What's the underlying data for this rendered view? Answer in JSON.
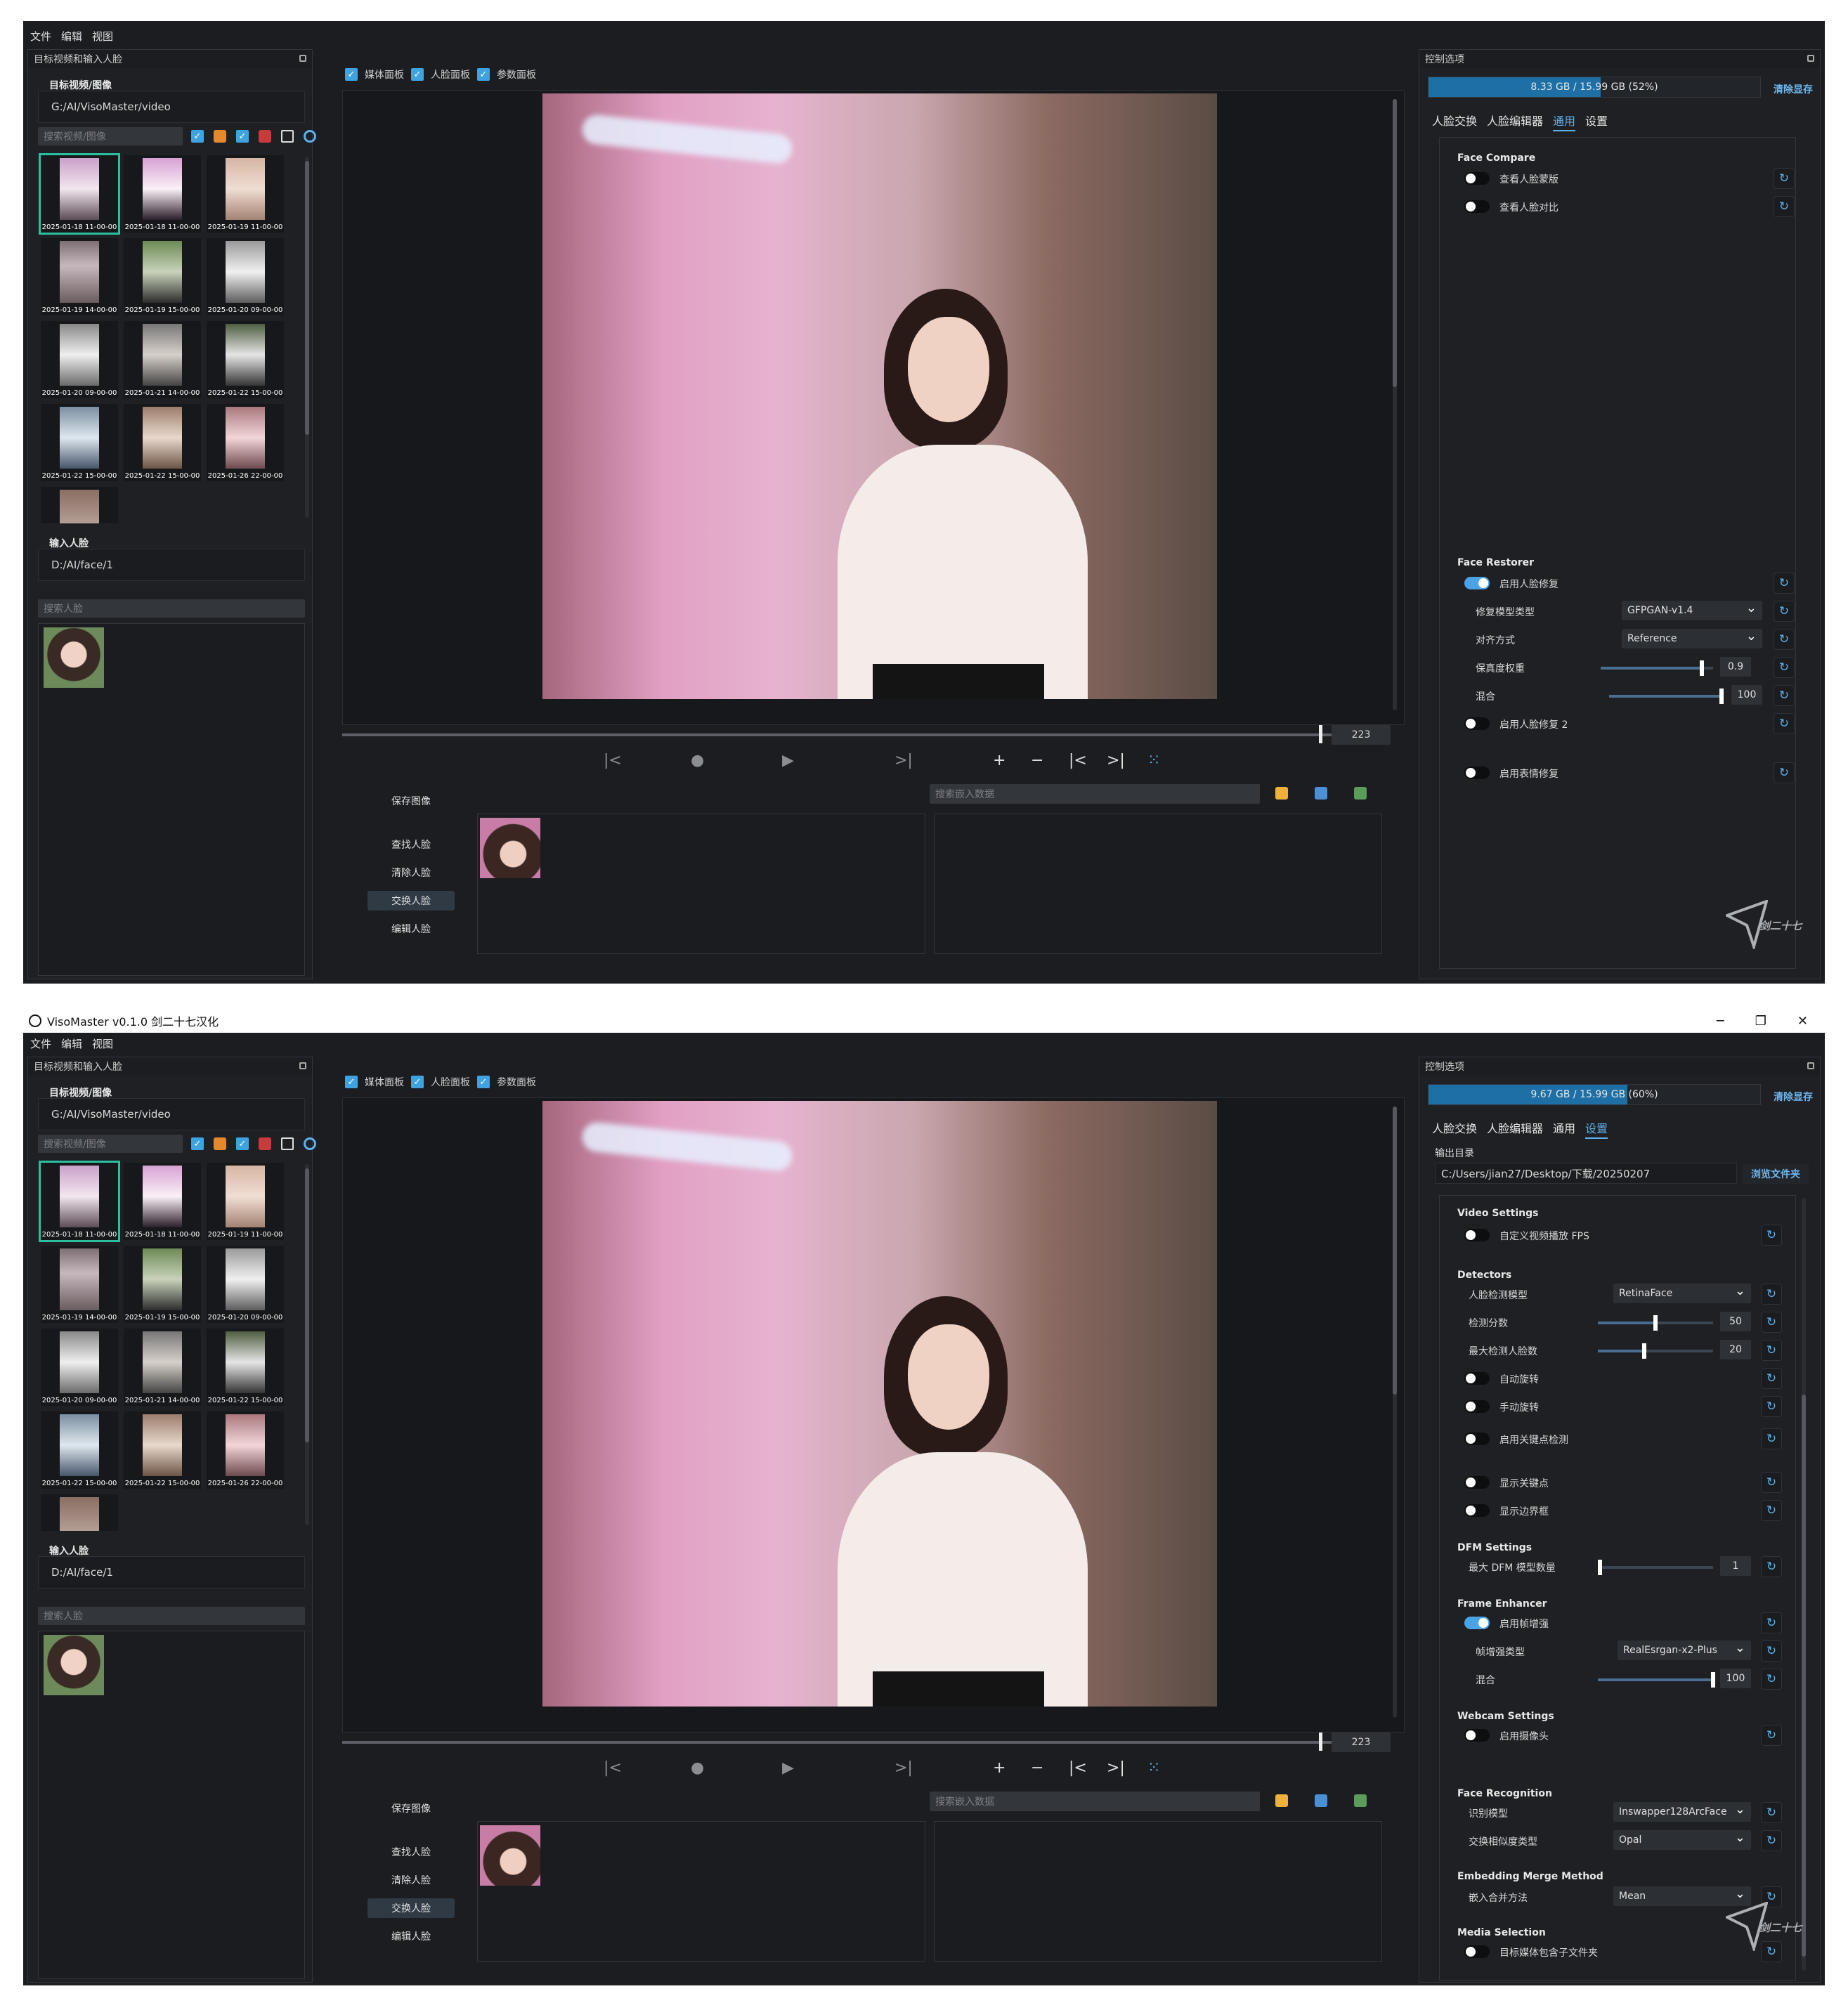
{
  "menu": [
    "文件",
    "编辑",
    "视图"
  ],
  "window_title": "VisoMaster v0.1.0 剑二十七汉化",
  "window_controls": {
    "minimize": "─",
    "restore": "❐",
    "close": "✕"
  },
  "left": {
    "dock_title": "目标视频和输入人脸",
    "target_label": "目标视频/图像",
    "target_path": "G:/AI/VisoMaster/video",
    "search_video_placeholder": "搜索视频/图像",
    "thumb_captions": [
      "2025-01-18 11-00-00",
      "2025-01-18 11-00-00",
      "2025-01-19 11-00-00",
      "2025-01-19 14-00-00",
      "2025-01-19 15-00-00",
      "2025-01-20 09-00-00",
      "2025-01-20 09-00-00",
      "2025-01-21 14-00-00",
      "2025-01-22 15-00-00",
      "2025-01-22 15-00-00",
      "2025-01-22 15-00-00",
      "2025-01-26 22-00-00",
      ""
    ],
    "input_face_label": "输入人脸",
    "input_face_path": "D:/AI/face/1",
    "search_face_placeholder": "搜索人脸"
  },
  "center": {
    "checkboxes": [
      "媒体面板",
      "人脸面板",
      "参数面板"
    ],
    "frame_number": "223",
    "save_image": "保存图像",
    "find_faces": "查找人脸",
    "clear_faces": "清除人脸",
    "swap_faces": "交换人脸",
    "edit_faces": "编辑人脸",
    "search_embed_placeholder": "搜索嵌入数据",
    "transport": {
      "prev": "|<",
      "record": "●",
      "play": "▶",
      "next": ">|",
      "plus": "+",
      "minus": "−",
      "first": "|<",
      "last": ">|",
      "grid": "⁙"
    }
  },
  "right_top": {
    "dock_title": "控制选项",
    "memory": {
      "text": "8.33 GB / 15.99 GB (52%)",
      "percent": 52
    },
    "clear_vram": "清除显存",
    "tabs": [
      "人脸交换",
      "人脸编辑器",
      "通用",
      "设置"
    ],
    "active_tab": "通用",
    "face_compare": "Face Compare",
    "view_mask": "查看人脸蒙版",
    "view_compare": "查看人脸对比",
    "face_restorer": "Face Restorer",
    "enable_restore": "启用人脸修复",
    "restore_model_label": "修复模型类型",
    "restore_model_value": "GFPGAN-v1.4",
    "align_label": "对齐方式",
    "align_value": "Reference",
    "fidelity_label": "保真度权重",
    "fidelity_value": "0.9",
    "fidelity_level": 0.9,
    "blend_label": "混合",
    "blend_value": "100",
    "blend_level": 1.0,
    "enable_restore2": "启用人脸修复 2",
    "enable_expression": "启用表情修复",
    "watermark": "剑二十七"
  },
  "right_bottom": {
    "dock_title": "控制选项",
    "memory": {
      "text": "9.67 GB / 15.99 GB (60%)",
      "percent": 60
    },
    "clear_vram": "清除显存",
    "tabs": [
      "人脸交换",
      "人脸编辑器",
      "通用",
      "设置"
    ],
    "active_tab": "设置",
    "output_dir_label": "输出目录",
    "output_dir": "C:/Users/jian27/Desktop/下载/20250207",
    "browse": "浏览文件夹",
    "video_settings": "Video Settings",
    "custom_fps": "自定义视频播放 FPS",
    "detectors": "Detectors",
    "detect_model_label": "人脸检测模型",
    "detect_model_value": "RetinaFace",
    "detect_score_label": "检测分数",
    "detect_score_value": "50",
    "detect_score_level": 0.5,
    "max_faces_label": "最大检测人脸数",
    "max_faces_value": "20",
    "max_faces_level": 0.4,
    "auto_rotate": "自动旋转",
    "manual_rotate": "手动旋转",
    "keypoint_detect": "启用关键点检测",
    "show_keypoints": "显示关键点",
    "show_bbox": "显示边界框",
    "dfm_settings": "DFM Settings",
    "max_dfm_label": "最大 DFM 模型数量",
    "max_dfm_value": "1",
    "max_dfm_level": 0.0,
    "frame_enhancer": "Frame Enhancer",
    "enable_enhancer": "启用帧增强",
    "enhancer_type_label": "帧增强类型",
    "enhancer_type_value": "RealEsrgan-x2-Plus",
    "enh_blend_label": "混合",
    "enh_blend_value": "100",
    "enh_blend_level": 1.0,
    "webcam_settings": "Webcam Settings",
    "enable_webcam": "启用摄像头",
    "face_recognition": "Face Recognition",
    "recog_model_label": "识别模型",
    "recog_model_value": "Inswapper128ArcFace",
    "swap_sim_label": "交换相似度类型",
    "swap_sim_value": "Opal",
    "embedding_merge": "Embedding Merge Method",
    "embed_merge_label": "嵌入合并方法",
    "embed_merge_value": "Mean",
    "media_selection": "Media Selection",
    "include_subfolders": "目标媒体包含子文件夹",
    "watermark": "剑二十七"
  },
  "colors": {
    "accent": "#5eb1ec",
    "toggle_on": "#4aa3e6",
    "selection": "#2bbfa0",
    "bg": "#1b1d21"
  }
}
